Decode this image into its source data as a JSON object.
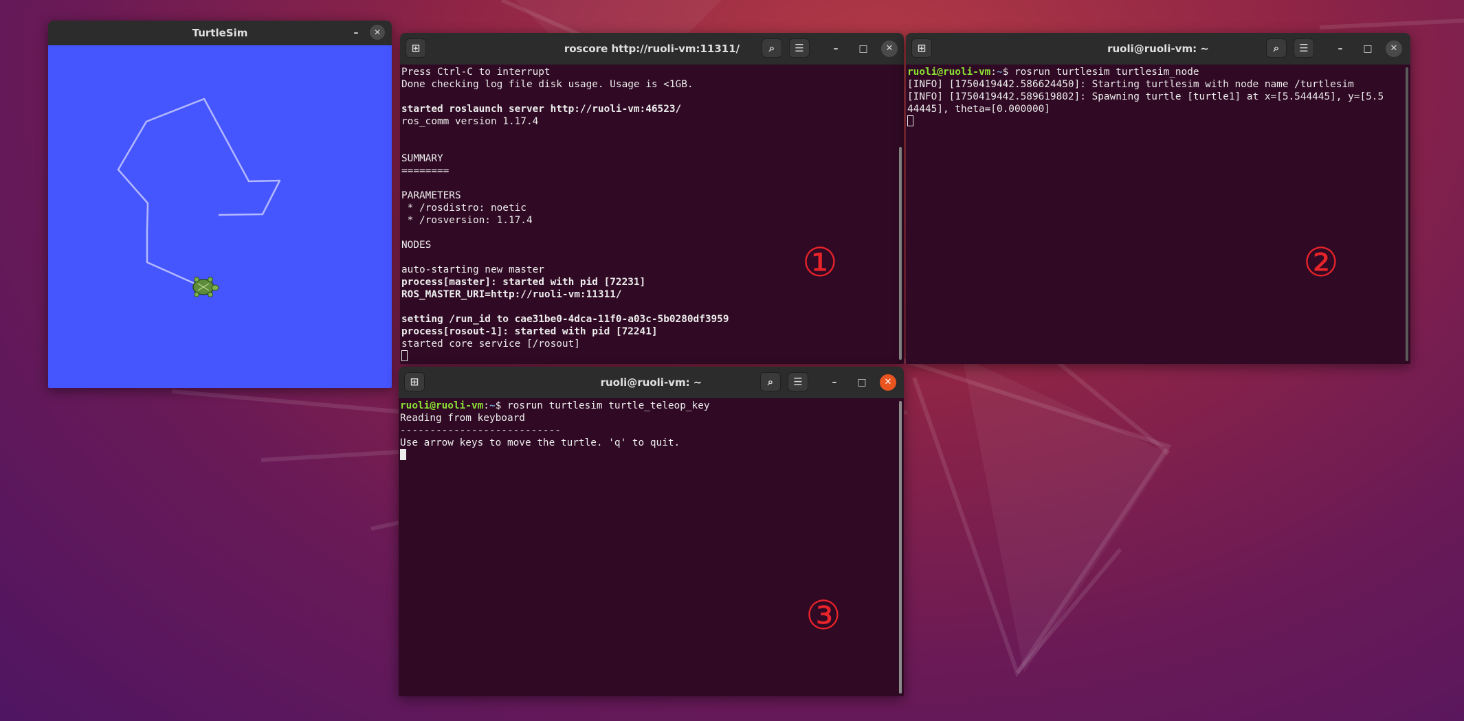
{
  "turtlesim": {
    "title": "TurtleSim",
    "canvas_color": "#4556ff",
    "path_color": "#b3b8ff",
    "minimize": "–",
    "close": "✕"
  },
  "window1": {
    "title": "roscore http://ruoli-vm:11311/",
    "marker": "①",
    "lines": [
      {
        "text": "Press Ctrl-C to interrupt",
        "bold": false
      },
      {
        "text": "Done checking log file disk usage. Usage is <1GB.",
        "bold": false
      },
      {
        "text": "",
        "bold": false
      },
      {
        "text": "started roslaunch server http://ruoli-vm:46523/",
        "bold": true
      },
      {
        "text": "ros_comm version 1.17.4",
        "bold": false
      },
      {
        "text": "",
        "bold": false
      },
      {
        "text": "",
        "bold": false
      },
      {
        "text": "SUMMARY",
        "bold": false
      },
      {
        "text": "========",
        "bold": false
      },
      {
        "text": "",
        "bold": false
      },
      {
        "text": "PARAMETERS",
        "bold": false
      },
      {
        "text": " * /rosdistro: noetic",
        "bold": false
      },
      {
        "text": " * /rosversion: 1.17.4",
        "bold": false
      },
      {
        "text": "",
        "bold": false
      },
      {
        "text": "NODES",
        "bold": false
      },
      {
        "text": "",
        "bold": false
      },
      {
        "text": "auto-starting new master",
        "bold": false
      },
      {
        "text": "process[master]: started with pid [72231]",
        "bold": true
      },
      {
        "text": "ROS_MASTER_URI=http://ruoli-vm:11311/",
        "bold": true
      },
      {
        "text": "",
        "bold": false
      },
      {
        "text": "setting /run_id to cae31be0-4dca-11f0-a03c-5b0280df3959",
        "bold": true
      },
      {
        "text": "process[rosout-1]: started with pid [72241]",
        "bold": true
      },
      {
        "text": "started core service [/rosout]",
        "bold": false
      }
    ]
  },
  "window2": {
    "title": "ruoli@ruoli-vm: ~",
    "marker": "②",
    "prompt_user": "ruoli@ruoli-vm",
    "prompt_sep": ":",
    "prompt_path": "~",
    "prompt_end": "$ ",
    "command": "rosrun turtlesim turtlesim_node",
    "lines": [
      "[INFO] [1750419442.586624450]: Starting turtlesim with node name /turtlesim",
      "[INFO] [1750419442.589619802]: Spawning turtle [turtle1] at x=[5.544445], y=[5.5",
      "44445], theta=[0.000000]"
    ]
  },
  "window3": {
    "title": "ruoli@ruoli-vm: ~",
    "marker": "③",
    "prompt_user": "ruoli@ruoli-vm",
    "prompt_sep": ":",
    "prompt_path": "~",
    "prompt_end": "$ ",
    "command": "rosrun turtlesim turtle_teleop_key",
    "lines": [
      "Reading from keyboard",
      "---------------------------",
      "Use arrow keys to move the turtle. 'q' to quit."
    ]
  },
  "controls": {
    "new_tab_icon": "⊞",
    "search_icon": "⌕",
    "menu_icon": "☰",
    "minimize": "–",
    "maximize": "□",
    "close": "✕"
  },
  "colors": {
    "terminal_bg": "#300a24",
    "prompt_user": "#8ae234",
    "prompt_path": "#729fcf",
    "close_active": "#e9541f",
    "marker": "#e8232a"
  }
}
